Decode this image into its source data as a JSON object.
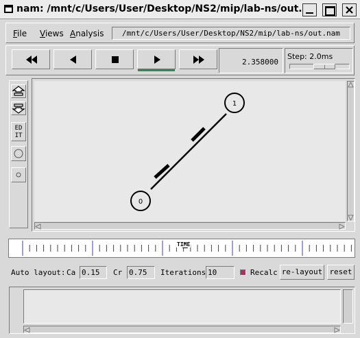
{
  "window": {
    "title": "nam: /mnt/c/Users/User/Desktop/NS2/mip/lab-ns/out..."
  },
  "menu": {
    "file": {
      "u": "F",
      "rest": "ile"
    },
    "views": {
      "u": "V",
      "rest": "iews"
    },
    "analysis": {
      "u": "A",
      "rest": "nalysis"
    },
    "path": "/mnt/c/Users/User/Desktop/NS2/mip/lab-ns/out.nam"
  },
  "transport": {
    "buttons": [
      "rewind-icon",
      "step-back-icon",
      "stop-icon",
      "play-icon",
      "fast-forward-icon"
    ],
    "active": "play",
    "time": "2.358000",
    "step_label": "Step: 2.0ms"
  },
  "tools": {
    "edit_label_1": "ED",
    "edit_label_2": "IT"
  },
  "canvas": {
    "nodes": [
      {
        "id": "0",
        "label": "0"
      },
      {
        "id": "1",
        "label": "1"
      }
    ],
    "links": [
      {
        "from": "0",
        "to": "1"
      }
    ]
  },
  "timeline": {
    "label": "TIME"
  },
  "controls": {
    "auto_layout": "Auto layout:",
    "ca_label": "Ca",
    "ca_value": "0.15",
    "cr_label": "Cr",
    "cr_value": "0.75",
    "iterations_label": "Iterations",
    "iterations_value": "10",
    "recalc_label": "Recalc",
    "recalc_checked": true,
    "relayout_button": "re-layout",
    "reset_button": "reset"
  },
  "colors": {
    "background": "#d9d9d9",
    "canvas": "#e8e8e8",
    "play_active": "#2e8b57",
    "recalc_check": "#b03060",
    "timeline_marker": "#3b3bb0"
  }
}
